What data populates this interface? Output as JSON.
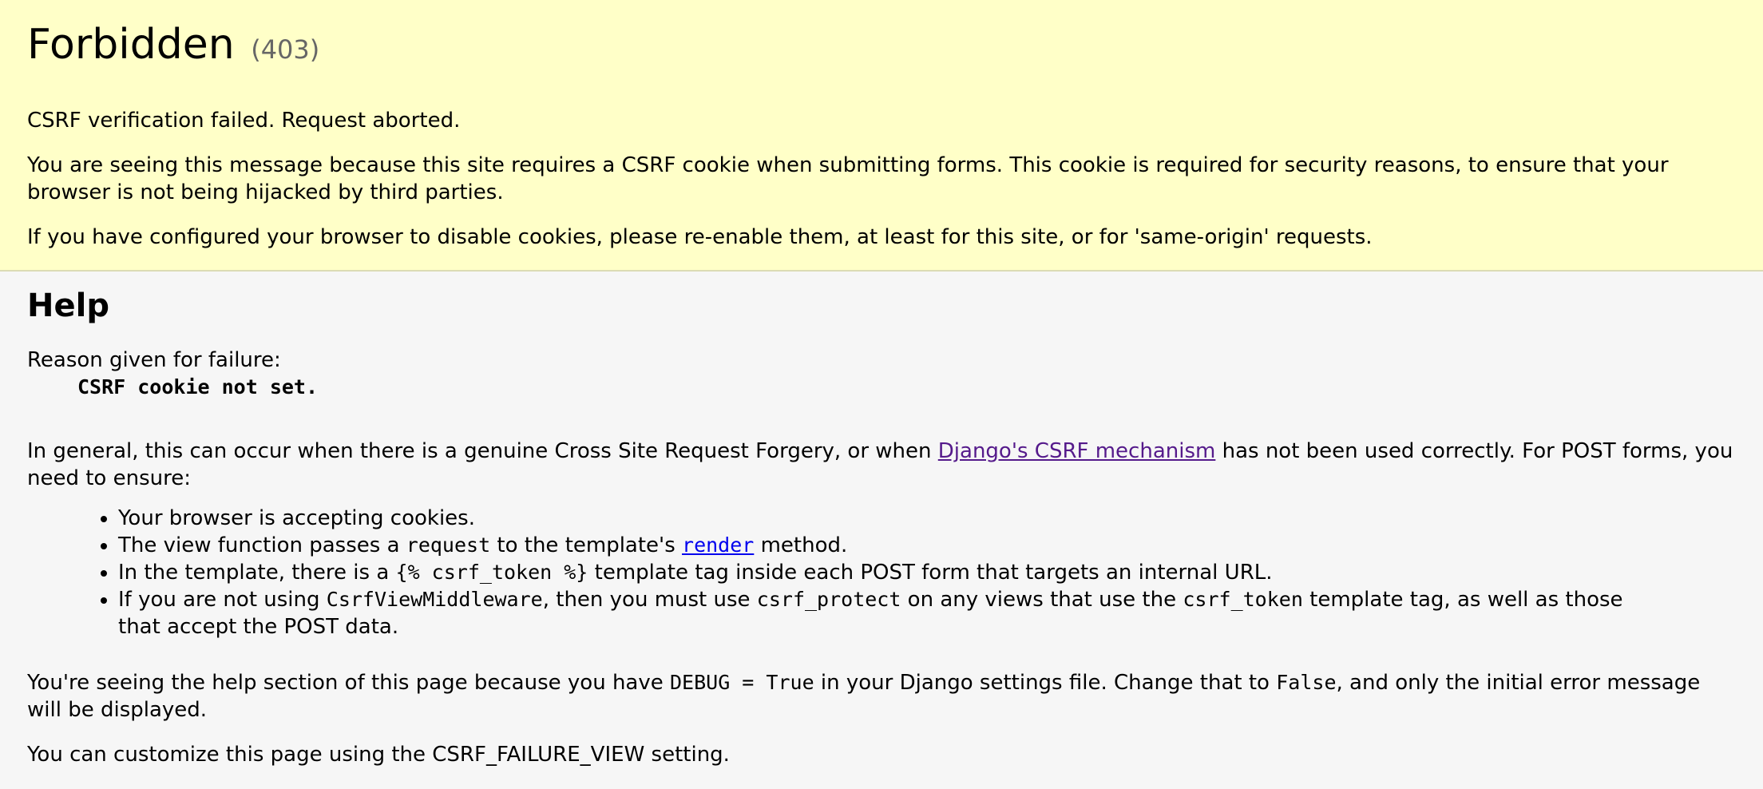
{
  "summary": {
    "title": "Forbidden",
    "status_code": "(403)",
    "message": "CSRF verification failed. Request aborted.",
    "explanation": "You are seeing this message because this site requires a CSRF cookie when submitting forms. This cookie is required for security reasons, to ensure that your browser is not being hijacked by third parties.",
    "cookies_note": "If you have configured your browser to disable cookies, please re-enable them, at least for this site, or for 'same-origin' requests."
  },
  "help": {
    "heading": "Help",
    "reason_label": "Reason given for failure:",
    "reason_value": "CSRF cookie not set.",
    "general_prefix": "In general, this can occur when there is a genuine Cross Site Request Forgery, or when ",
    "general_link": "Django's CSRF mechanism",
    "general_suffix": " has not been used correctly. For POST forms, you need to ensure:",
    "bullets": {
      "b1": "Your browser is accepting cookies.",
      "b2_a": "The view function passes a ",
      "b2_code": "request",
      "b2_b": " to the template's ",
      "b2_link": "render",
      "b2_c": " method.",
      "b3_a": "In the template, there is a ",
      "b3_code": "{% csrf_token %}",
      "b3_b": " template tag inside each POST form that targets an internal URL.",
      "b4_a": "If you are not using ",
      "b4_code1": "CsrfViewMiddleware",
      "b4_b": ", then you must use ",
      "b4_code2": "csrf_protect",
      "b4_c": " on any views that use the ",
      "b4_code3": "csrf_token",
      "b4_d": " template tag, as well as those that accept the POST data."
    },
    "debug_a": "You're seeing the help section of this page because you have ",
    "debug_code1": "DEBUG = True",
    "debug_b": " in your Django settings file. Change that to ",
    "debug_code2": "False",
    "debug_c": ", and only the initial error message will be displayed.",
    "customize": "You can customize this page using the CSRF_FAILURE_VIEW setting."
  }
}
